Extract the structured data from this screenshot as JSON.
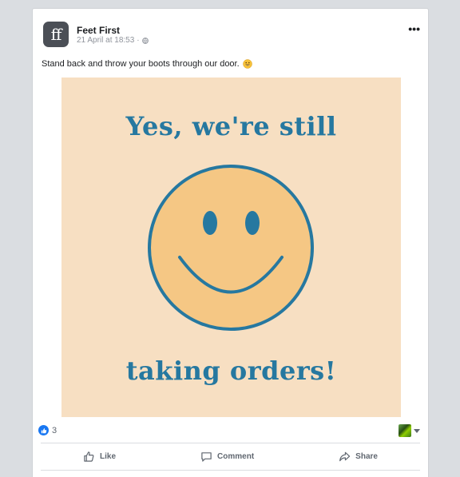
{
  "post": {
    "author": "Feet First",
    "avatar_text": "ff",
    "timestamp": "21 April at 18:53",
    "separator": "·",
    "privacy_icon": "globe-icon",
    "more_label": "•••",
    "text": "Stand back and throw your boots through our door.",
    "emoji_icon": "grinning-emoji-icon"
  },
  "image": {
    "line1": "Yes, we're still",
    "line2": "taking orders!",
    "background": "#f7dfc2",
    "face_color": "#f5c784",
    "ink_color": "#2678a0"
  },
  "reactions": {
    "icon": "like-reaction-icon",
    "count": "3"
  },
  "actions": {
    "like": "Like",
    "comment": "Comment",
    "share": "Share"
  },
  "colors": {
    "like_blue": "#1877f2",
    "text_secondary": "#606770"
  }
}
